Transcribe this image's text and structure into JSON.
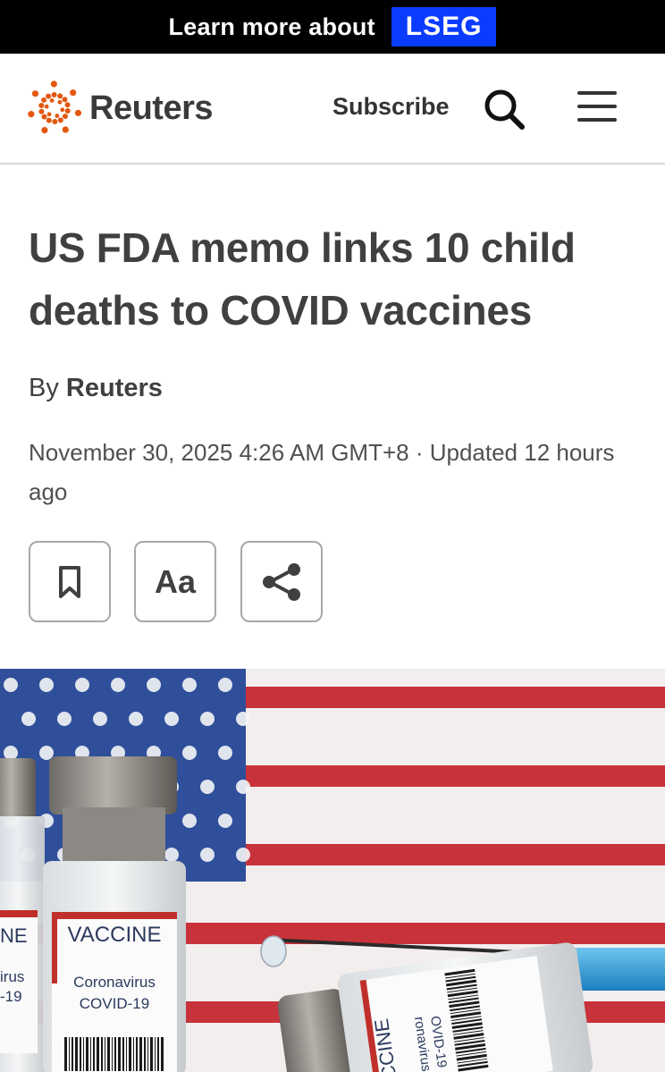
{
  "ad": {
    "text": "Learn more about",
    "brand": "LSEG",
    "brand_color": "#0a3cff"
  },
  "header": {
    "logo_text": "Reuters",
    "logo_color": "#e2580e",
    "subscribe_label": "Subscribe",
    "search_icon": "search-icon",
    "menu_icon": "hamburger-menu-icon"
  },
  "article": {
    "headline_line1": "US FDA memo links 10 child",
    "headline_line2": "deaths to COVID vaccines",
    "byline_prefix": "By",
    "byline_author": "Reuters",
    "dateline": "November 30, 2025 4:26 AM GMT+8 · Updated 12 hours ago"
  },
  "tools": {
    "bookmark_icon": "bookmark-icon",
    "font_size_label": "Aa",
    "share_icon": "share-icon"
  },
  "photo": {
    "vial_left_text": "NE",
    "vial_left_sub1": "irus",
    "vial_left_sub2": "-19",
    "vial_main_label": "VACCINE",
    "vial_main_sub1": "Coronavirus",
    "vial_main_sub2": "COVID-19",
    "vial_lying_label": "CCINE",
    "vial_lying_sub1": "ronavirus",
    "vial_lying_sub2": "OVID-19"
  }
}
